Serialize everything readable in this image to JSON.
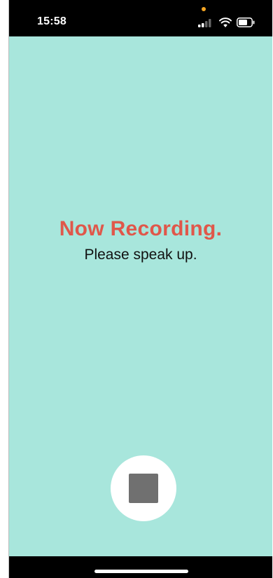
{
  "status_bar": {
    "time": "15:58",
    "icons": [
      "microphone-indicator-icon",
      "cellular-signal-icon",
      "wifi-icon",
      "battery-icon"
    ]
  },
  "recording": {
    "headline": "Now Recording.",
    "subtext": "Please speak up."
  },
  "controls": {
    "stop_button_icon": "stop-icon"
  },
  "colors": {
    "background": "#A8E6DC",
    "headline": "#E0574A",
    "stop_icon": "#707070",
    "mic_indicator": "#F5A623"
  }
}
